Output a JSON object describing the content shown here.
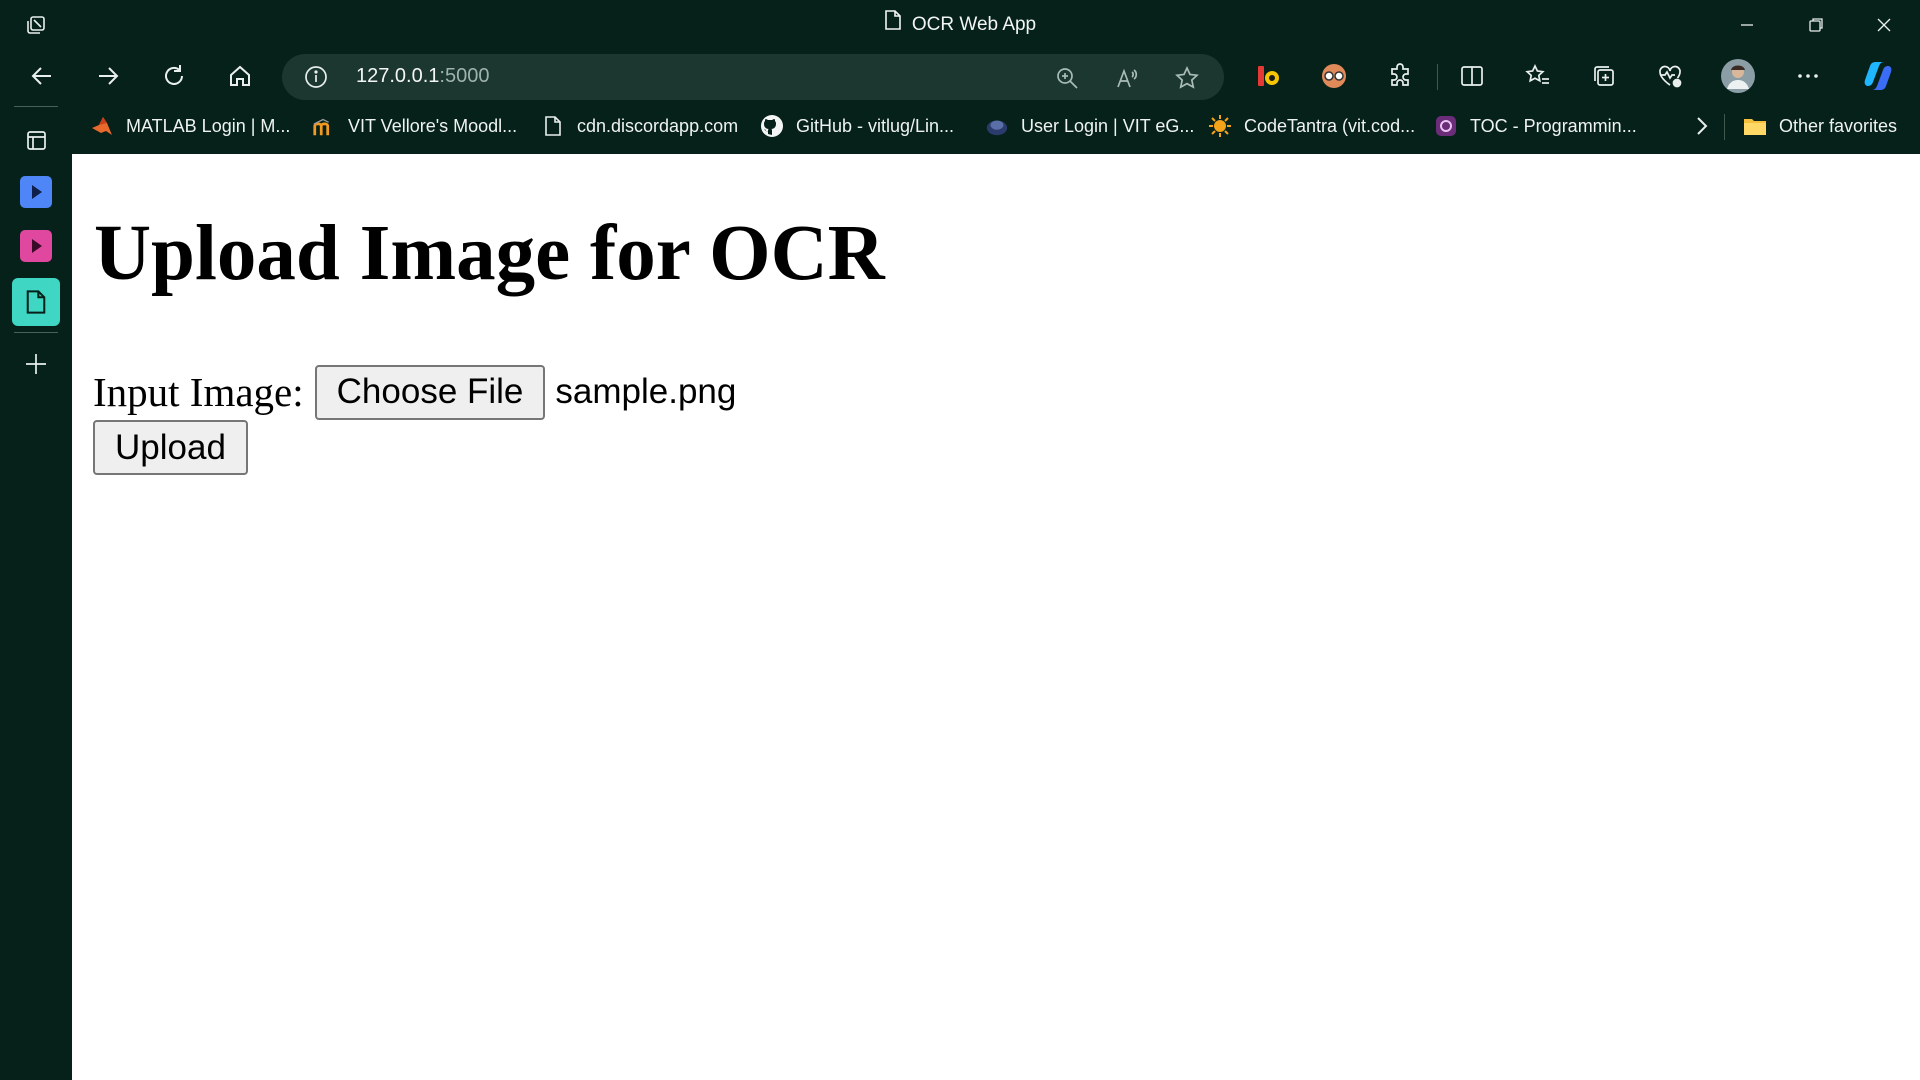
{
  "window": {
    "title": "OCR Web App"
  },
  "toolbar": {
    "url_host": "127.0.0.1",
    "url_port": ":5000"
  },
  "favorites": [
    {
      "label": "MATLAB Login | M...",
      "icon": "matlab-icon"
    },
    {
      "label": "VIT Vellore's Moodl...",
      "icon": "moodle-icon"
    },
    {
      "label": "cdn.discordapp.com",
      "icon": "page-icon"
    },
    {
      "label": "GitHub - vitlug/Lin...",
      "icon": "github-icon"
    },
    {
      "label": "User Login | VIT eG...",
      "icon": "vit-egov-icon"
    },
    {
      "label": "CodeTantra (vit.cod...",
      "icon": "codetantra-icon"
    },
    {
      "label": "TOC - Programmin...",
      "icon": "toc-icon"
    }
  ],
  "other_favorites": "Other favorites",
  "page": {
    "heading": "Upload Image for OCR",
    "input_label": "Input Image:",
    "choose_button": "Choose File",
    "file_name": "sample.png",
    "upload_button": "Upload"
  },
  "colors": {
    "chrome_bg": "#06201a",
    "address_bg": "#1c3630",
    "sidebar_blue": "#4f86f7",
    "sidebar_pink": "#e0479e",
    "sidebar_teal": "#3fd6c3"
  }
}
